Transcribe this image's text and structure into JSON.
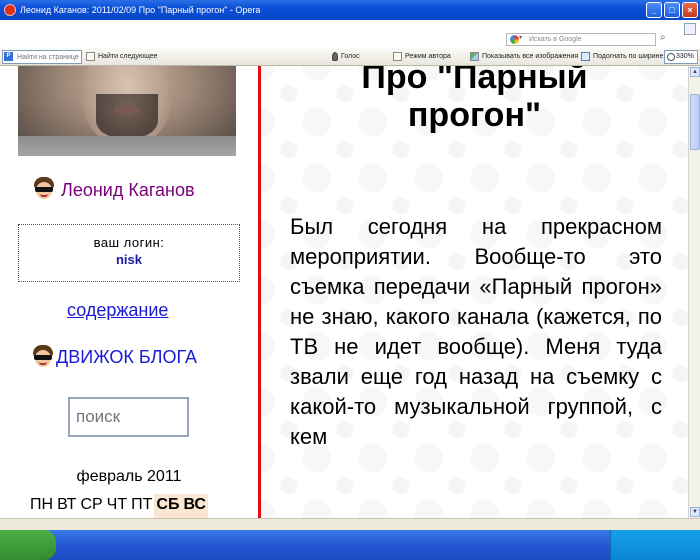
{
  "window": {
    "title": "Леонид Каганов: 2011/02/09 Про \"Парный прогон\" - Opera"
  },
  "menubar": {
    "search_placeholder": "Искать в Google"
  },
  "toolbar": {
    "find_placeholder": "Найти на странице",
    "find_next_label": "Найти следующее",
    "voice_label": "Голос",
    "author_mode_label": "Режим автора",
    "show_images_label": "Показывать все изображения",
    "fit_width_label": "Подогнать по ширине",
    "zoom_value": "330%"
  },
  "sidebar": {
    "author_name": "Леонид Каганов",
    "login_label": "ваш логин:",
    "login_user": "nisk",
    "contents_link": "содержание",
    "engine_link": "ДВИЖОК БЛОГА",
    "search_placeholder": "поиск",
    "calendar": {
      "month": "февраль 2011",
      "weekdays": [
        {
          "label": "ПН",
          "weekend": false
        },
        {
          "label": "ВТ",
          "weekend": false
        },
        {
          "label": "СР",
          "weekend": false
        },
        {
          "label": "ЧТ",
          "weekend": false
        },
        {
          "label": "ПТ",
          "weekend": false
        },
        {
          "label": "СБ",
          "weekend": true
        },
        {
          "label": "ВС",
          "weekend": true
        }
      ]
    }
  },
  "article": {
    "title_line1": "Про \"Парный",
    "title_line2": "прогон\"",
    "body": "Был сегодня на прекрасном мероприятии. Вообще-то это съемка передачи «Парный прогон» не знаю, какого канала (кажется, по ТВ не идет вообще). Меня туда звали еще год назад на съемку с какой-то музыкальной группой, с кем"
  },
  "colors": {
    "divider": "#e01010",
    "link": "#1a1ad6",
    "author": "#7a007a",
    "weekend_bg": "#fbe6d4"
  }
}
